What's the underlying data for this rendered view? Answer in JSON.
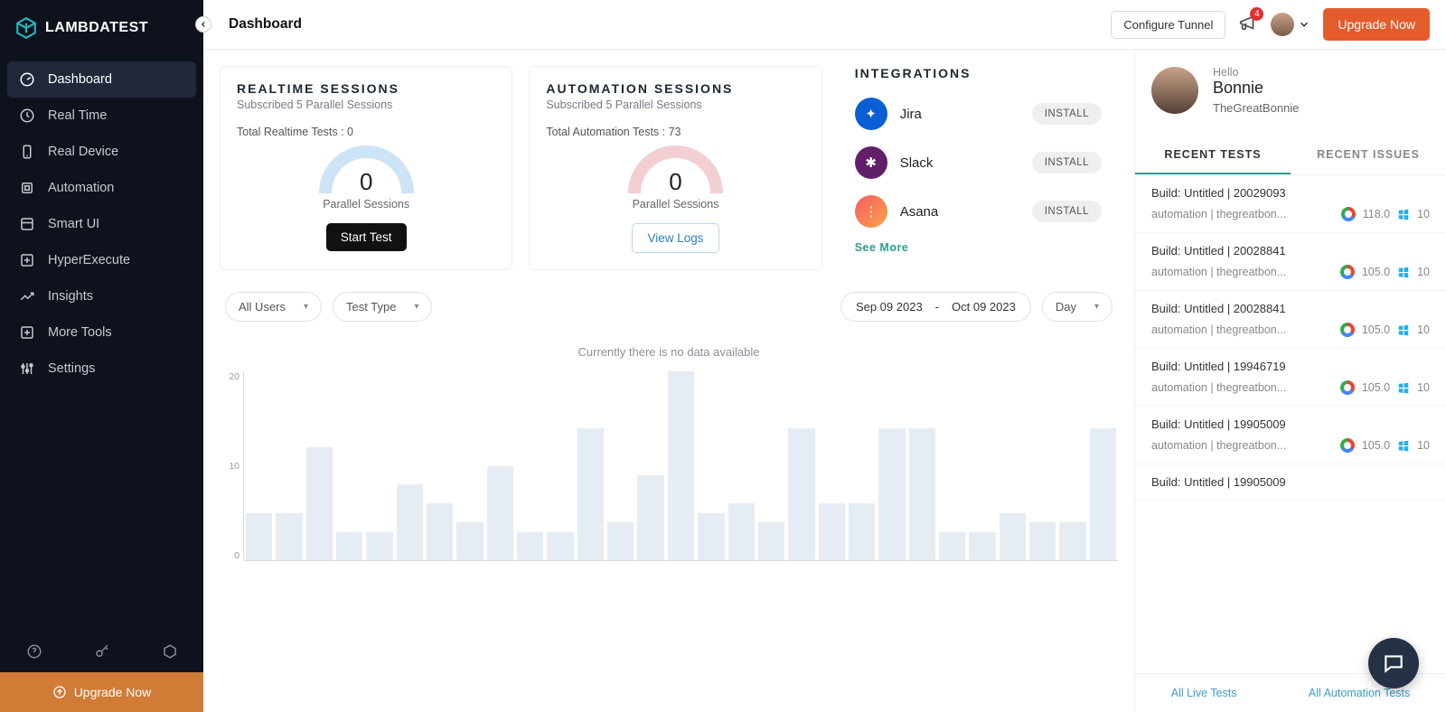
{
  "brand": "LAMBDATEST",
  "sidebar": {
    "items": [
      {
        "label": "Dashboard",
        "icon": "gauge"
      },
      {
        "label": "Real Time",
        "icon": "clock"
      },
      {
        "label": "Real Device",
        "icon": "device"
      },
      {
        "label": "Automation",
        "icon": "cpu"
      },
      {
        "label": "Smart UI",
        "icon": "layers"
      },
      {
        "label": "HyperExecute",
        "icon": "bolt"
      },
      {
        "label": "Insights",
        "icon": "trend"
      },
      {
        "label": "More Tools",
        "icon": "plus"
      },
      {
        "label": "Settings",
        "icon": "sliders"
      }
    ],
    "upgrade_label": "Upgrade Now"
  },
  "topbar": {
    "page_title": "Dashboard",
    "tunnel_label": "Configure Tunnel",
    "notifications_badge": "4",
    "upgrade_label": "Upgrade Now"
  },
  "realtime": {
    "title": "REALTIME SESSIONS",
    "subscribed": "Subscribed 5 Parallel Sessions",
    "total": "Total Realtime Tests : 0",
    "value": "0",
    "label": "Parallel Sessions",
    "button": "Start Test"
  },
  "automation": {
    "title": "AUTOMATION SESSIONS",
    "subscribed": "Subscribed 5 Parallel Sessions",
    "total": "Total Automation Tests : 73",
    "value": "0",
    "label": "Parallel Sessions",
    "button": "View Logs"
  },
  "integrations": {
    "title": "INTEGRATIONS",
    "items": [
      {
        "name": "Jira",
        "action": "INSTALL",
        "logo": "jira"
      },
      {
        "name": "Slack",
        "action": "INSTALL",
        "logo": "slack"
      },
      {
        "name": "Asana",
        "action": "INSTALL",
        "logo": "asana"
      }
    ],
    "see_more": "See More"
  },
  "filters": {
    "users": "All Users",
    "type": "Test Type",
    "date_from": "Sep 09 2023",
    "date_sep": "-",
    "date_to": "Oct 09 2023",
    "granularity": "Day"
  },
  "chart_msg": "Currently there is no data available",
  "chart_data": {
    "type": "bar",
    "ylabel": "",
    "xlabel": "",
    "title": "",
    "ylim": [
      0,
      20
    ],
    "yticks": [
      "20",
      "10",
      "0"
    ],
    "values": [
      5,
      5,
      12,
      3,
      3,
      8,
      6,
      4,
      10,
      3,
      3,
      14,
      4,
      9,
      20,
      5,
      6,
      4,
      14,
      6,
      6,
      14,
      14,
      3,
      3,
      5,
      4,
      4,
      14
    ]
  },
  "profile": {
    "hello": "Hello",
    "name": "Bonnie",
    "handle": "TheGreatBonnie"
  },
  "tabs": {
    "recent_tests": "RECENT TESTS",
    "recent_issues": "RECENT ISSUES"
  },
  "recent_tests": [
    {
      "build": "Build: Untitled | 20029093",
      "user": "automation | thegreatbon...",
      "browser_ver": "118.0",
      "os_ver": "10"
    },
    {
      "build": "Build: Untitled | 20028841",
      "user": "automation | thegreatbon...",
      "browser_ver": "105.0",
      "os_ver": "10"
    },
    {
      "build": "Build: Untitled | 20028841",
      "user": "automation | thegreatbon...",
      "browser_ver": "105.0",
      "os_ver": "10"
    },
    {
      "build": "Build: Untitled | 19946719",
      "user": "automation | thegreatbon...",
      "browser_ver": "105.0",
      "os_ver": "10"
    },
    {
      "build": "Build: Untitled | 19905009",
      "user": "automation | thegreatbon...",
      "browser_ver": "105.0",
      "os_ver": "10"
    },
    {
      "build": "Build: Untitled | 19905009",
      "user": "",
      "browser_ver": "",
      "os_ver": ""
    }
  ],
  "bottom_links": {
    "live": "All Live Tests",
    "auto": "All Automation Tests"
  }
}
